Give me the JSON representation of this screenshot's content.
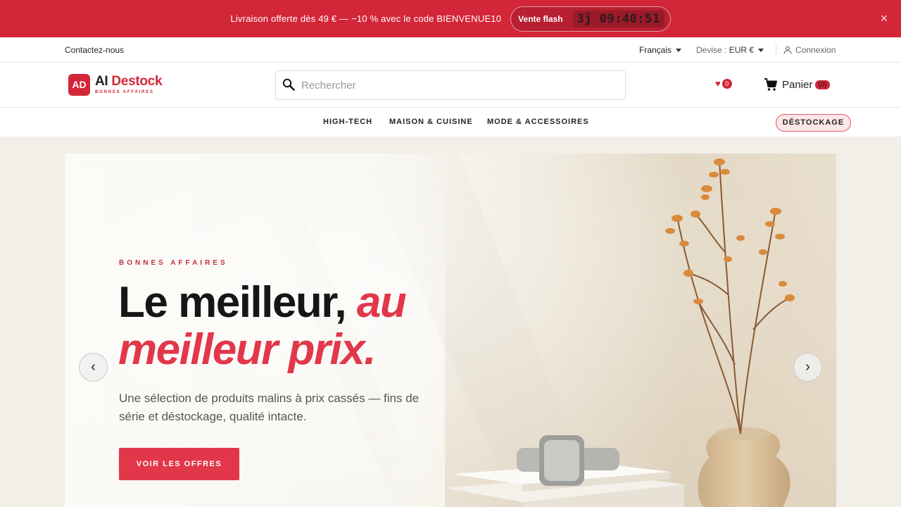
{
  "promo": {
    "text": "Livraison offerte dès 49 € — −10 % avec le code BIENVENUE10",
    "flash_label": "Vente flash",
    "countdown": "3j 09:40:51",
    "close": "×"
  },
  "utility": {
    "contact": "Contactez-nous",
    "language": "Français",
    "currency_label": "Devise :",
    "currency_value": "EUR €",
    "login": "Connexion"
  },
  "brand": {
    "logo_initials": "AD",
    "name_part1": "AI",
    "name_part2": "Destock",
    "tagline": "BONNES AFFAIRES"
  },
  "search": {
    "placeholder": "Rechercher"
  },
  "wishlist": {
    "count": "0"
  },
  "cart": {
    "label": "Panier",
    "count": "(0)"
  },
  "nav": {
    "items": [
      "HIGH-TECH",
      "MAISON & CUISINE",
      "MODE & ACCESSOIRES"
    ],
    "destock": "DÉSTOCKAGE"
  },
  "hero": {
    "eyebrow": "BONNES AFFAIRES",
    "headline_plain": "Le meilleur,",
    "headline_accent_1": "au",
    "headline_accent_2": "meilleur prix.",
    "subtext": "Une sélection de produits malins à prix cassés — fins de série et déstockage, qualité intacte.",
    "cta": "VOIR LES OFFRES",
    "prev": "‹",
    "next": "›"
  },
  "colors": {
    "brand_red": "#d32638",
    "accent_red": "#e2374a",
    "pill_bg": "#fde6e8"
  },
  "icons": [
    "close-icon",
    "caret-down-icon",
    "user-icon",
    "search-icon",
    "heart-icon",
    "cart-icon",
    "chevron-left-icon",
    "chevron-right-icon"
  ]
}
